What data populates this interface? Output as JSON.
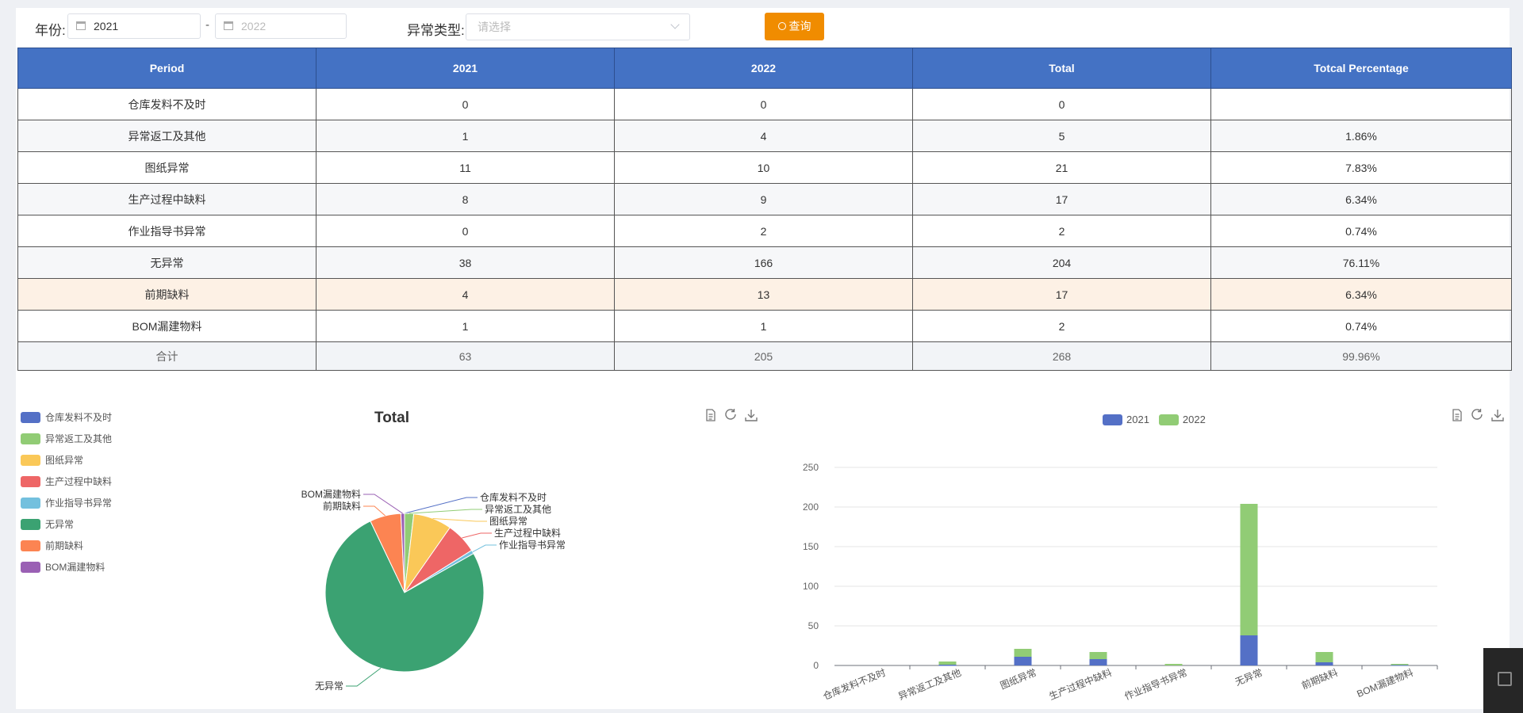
{
  "filter": {
    "year_label": "年份:",
    "year_from": "2021",
    "year_to_placeholder": "2022",
    "range_sep": "-",
    "type_label": "异常类型:",
    "type_placeholder": "请选择",
    "query_label": "查询"
  },
  "table": {
    "headers": [
      "Period",
      "2021",
      "2022",
      "Total",
      "Totcal Percentage"
    ],
    "rows": [
      [
        "仓库发料不及时",
        "0",
        "0",
        "0",
        ""
      ],
      [
        "异常返工及其他",
        "1",
        "4",
        "5",
        "1.86%"
      ],
      [
        "图纸异常",
        "11",
        "10",
        "21",
        "7.83%"
      ],
      [
        "生产过程中缺料",
        "8",
        "9",
        "17",
        "6.34%"
      ],
      [
        "作业指导书异常",
        "0",
        "2",
        "2",
        "0.74%"
      ],
      [
        "无异常",
        "38",
        "166",
        "204",
        "76.11%"
      ],
      [
        "前期缺料",
        "4",
        "13",
        "17",
        "6.34%"
      ],
      [
        "BOM漏建物料",
        "1",
        "1",
        "2",
        "0.74%"
      ]
    ],
    "total_row": [
      "合计",
      "63",
      "205",
      "268",
      "99.96%"
    ]
  },
  "colors": {
    "header_bg": "#4472c4",
    "query_btn": "#f08c00",
    "highlight_row": "#fdf1e5"
  },
  "icons": [
    "calendar-icon",
    "chevron-down-icon",
    "search-icon",
    "data-view-icon",
    "restore-icon",
    "download-icon"
  ],
  "chart_data": [
    {
      "type": "pie",
      "title": "Total",
      "categories": [
        "仓库发料不及时",
        "异常返工及其他",
        "图纸异常",
        "生产过程中缺料",
        "作业指导书异常",
        "无异常",
        "前期缺料",
        "BOM漏建物料"
      ],
      "values": [
        0,
        5,
        21,
        17,
        2,
        204,
        17,
        2
      ],
      "colors": [
        "#5470c6",
        "#91cc75",
        "#fac858",
        "#ee6666",
        "#73c0de",
        "#3ba272",
        "#fc8452",
        "#9a60b4"
      ],
      "legend_position": "left"
    },
    {
      "type": "bar",
      "stacked": true,
      "categories": [
        "仓库发料不及时",
        "异常返工及其他",
        "图纸异常",
        "生产过程中缺料",
        "作业指导书异常",
        "无异常",
        "前期缺料",
        "BOM漏建物料"
      ],
      "series": [
        {
          "name": "2021",
          "values": [
            0,
            1,
            11,
            8,
            0,
            38,
            4,
            1
          ],
          "color": "#5470c6"
        },
        {
          "name": "2022",
          "values": [
            0,
            4,
            10,
            9,
            2,
            166,
            13,
            1
          ],
          "color": "#91cc75"
        }
      ],
      "yticks": [
        "0",
        "50",
        "100",
        "150",
        "200",
        "250"
      ],
      "ylim": [
        0,
        250
      ],
      "legend_position": "top"
    }
  ]
}
